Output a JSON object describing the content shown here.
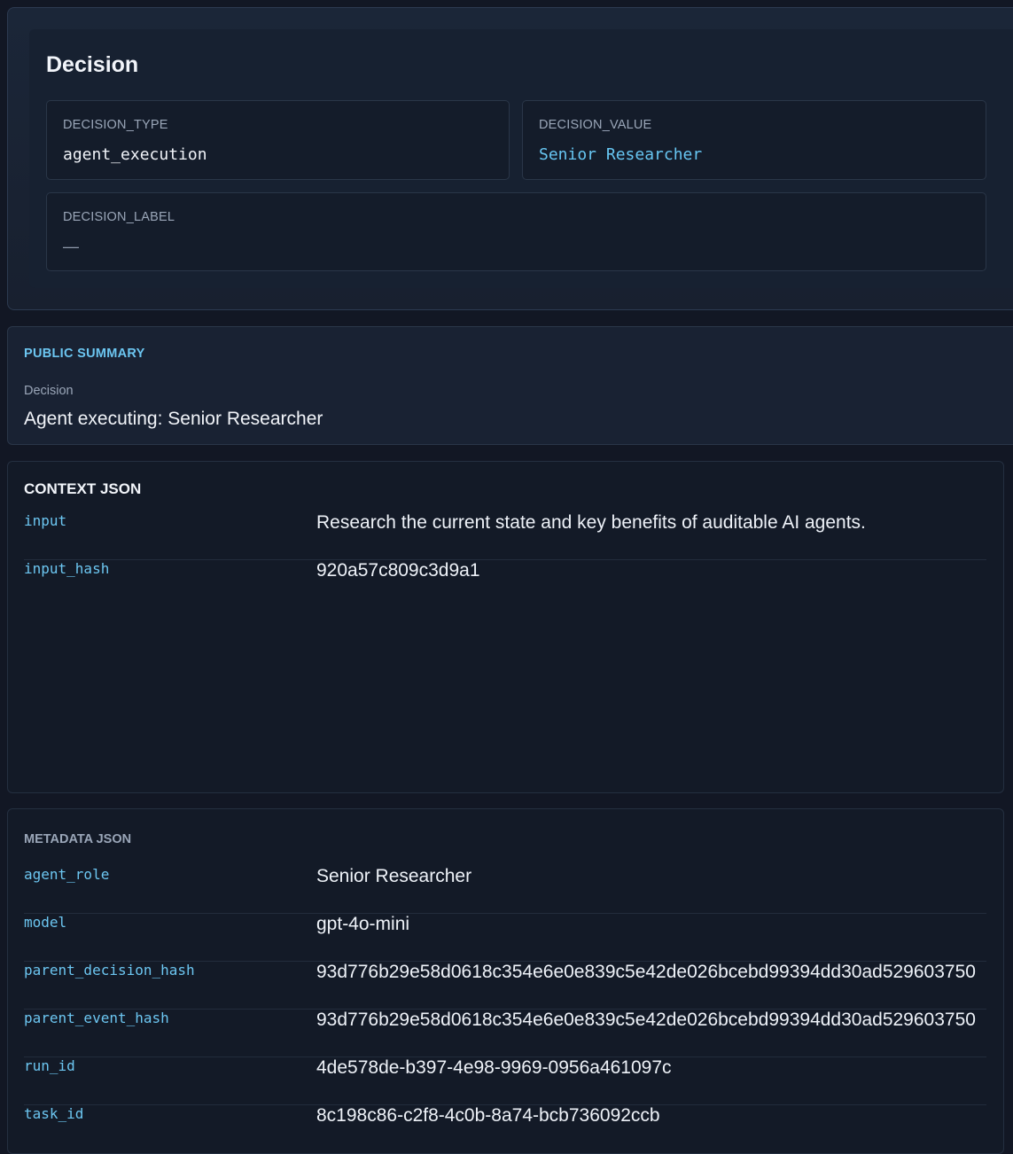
{
  "decision": {
    "title": "Decision",
    "decision_type": {
      "label": "DECISION_TYPE",
      "value": "agent_execution"
    },
    "decision_value": {
      "label": "DECISION_VALUE",
      "value": "Senior Researcher"
    },
    "decision_label": {
      "label": "DECISION_LABEL",
      "value": "—"
    }
  },
  "public_summary": {
    "heading": "PUBLIC SUMMARY",
    "label": "Decision",
    "value": "Agent executing: Senior Researcher"
  },
  "context_json": {
    "heading": "CONTEXT JSON",
    "rows": [
      {
        "key": "input",
        "value": "Research the current state and key benefits of auditable AI agents."
      },
      {
        "key": "input_hash",
        "value": "920a57c809c3d9a1"
      }
    ]
  },
  "metadata_json": {
    "heading": "METADATA JSON",
    "rows": [
      {
        "key": "agent_role",
        "value": "Senior Researcher"
      },
      {
        "key": "model",
        "value": "gpt-4o-mini"
      },
      {
        "key": "parent_decision_hash",
        "value": "93d776b29e58d0618c354e6e0e839c5e42de026bcebd99394dd30ad529603750"
      },
      {
        "key": "parent_event_hash",
        "value": "93d776b29e58d0618c354e6e0e839c5e42de026bcebd99394dd30ad529603750"
      },
      {
        "key": "run_id",
        "value": "4de578de-b397-4e98-9969-0956a461097c"
      },
      {
        "key": "task_id",
        "value": "8c198c86-c2f8-4c0b-8a74-bcb736092ccb"
      }
    ]
  }
}
